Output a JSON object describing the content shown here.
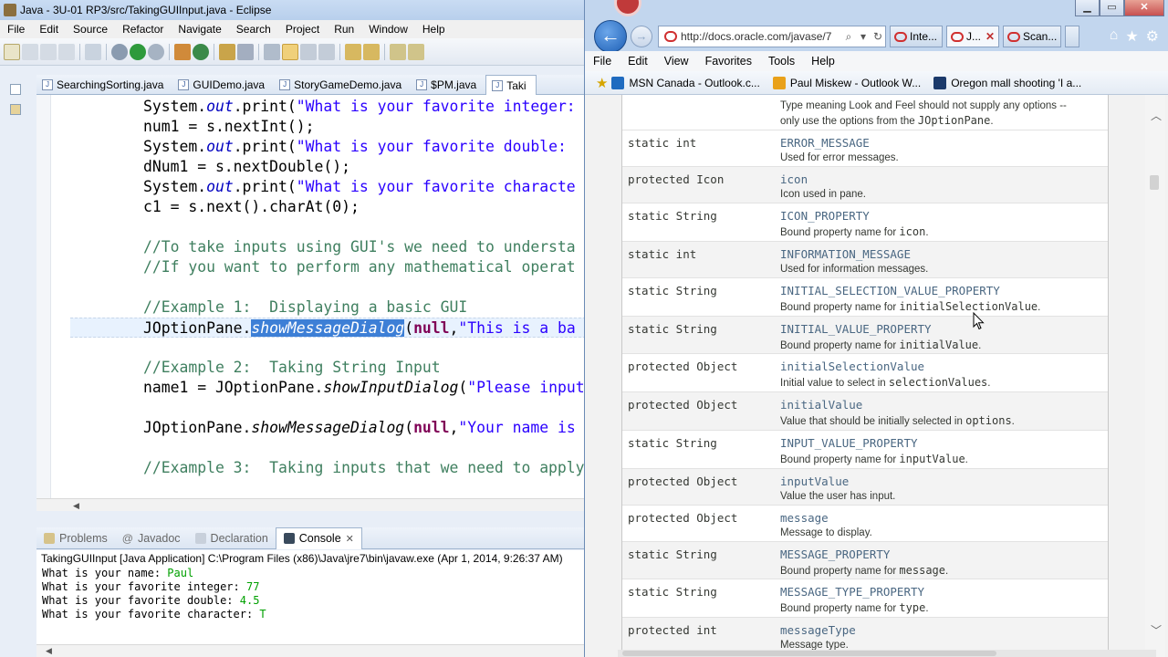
{
  "eclipse": {
    "title": "Java - 3U-01 RP3/src/TakingGUIInput.java - Eclipse",
    "menu": [
      "File",
      "Edit",
      "Source",
      "Refactor",
      "Navigate",
      "Search",
      "Project",
      "Run",
      "Window",
      "Help"
    ],
    "tabs": [
      "SearchingSorting.java",
      "GUIDemo.java",
      "StoryGameDemo.java",
      "$PM.java",
      "Taki"
    ],
    "code": [
      "System.out.print(\"What is your favorite integer:",
      "num1 = s.nextInt();",
      "System.out.print(\"What is your favorite double: ",
      "dNum1 = s.nextDouble();",
      "System.out.print(\"What is your favorite characte",
      "c1 = s.next().charAt(0);",
      "",
      "//To take inputs using GUI's we need to understa",
      "//If you want to perform any mathematical operat",
      "",
      "//Example 1:  Displaying a basic GUI",
      "JOptionPane.showMessageDialog(null,\"This is a ba",
      "",
      "//Example 2:  Taking String Input",
      "name1 = JOptionPane.showInputDialog(\"Please input",
      "",
      "JOptionPane.showMessageDialog(null,\"Your name is",
      "",
      "//Example 3:  Taking inputs that we need to apply"
    ],
    "bottom_tabs": [
      "Problems",
      "Javadoc",
      "Declaration",
      "Console"
    ],
    "console_header": "TakingGUIInput [Java Application] C:\\Program Files (x86)\\Java\\jre7\\bin\\javaw.exe (Apr 1, 2014, 9:26:37 AM)",
    "console": [
      {
        "prompt": "What is your name: ",
        "input": "Paul"
      },
      {
        "prompt": "What is your favorite integer: ",
        "input": "77"
      },
      {
        "prompt": "What is your favorite double: ",
        "input": "4.5"
      },
      {
        "prompt": "What is your favorite character: ",
        "input": "T"
      }
    ]
  },
  "browser": {
    "address": "http://docs.oracle.com/javase/7",
    "tabs": [
      "Inte...",
      "J...",
      "Scan..."
    ],
    "menu": [
      "File",
      "Edit",
      "View",
      "Favorites",
      "Tools",
      "Help"
    ],
    "favorites": [
      "MSN Canada - Outlook.c...",
      "Paul Miskew - Outlook W...",
      "Oregon mall shooting 'I a..."
    ],
    "top_partial": "Type meaning Look and Feel should not supply any options --",
    "top_partial2": "only use the options from the",
    "top_partial2_code": "JOptionPane",
    "fields": [
      {
        "mod": "static int",
        "name": "ERROR_MESSAGE",
        "desc": "Used for error messages.",
        "code": ""
      },
      {
        "mod": "protected Icon",
        "name": "icon",
        "desc": "Icon used in pane.",
        "code": ""
      },
      {
        "mod": "static String",
        "name": "ICON_PROPERTY",
        "desc": "Bound property name for",
        "code": "icon"
      },
      {
        "mod": "static int",
        "name": "INFORMATION_MESSAGE",
        "desc": "Used for information messages.",
        "code": ""
      },
      {
        "mod": "static String",
        "name": "INITIAL_SELECTION_VALUE_PROPERTY",
        "desc": "Bound property name for",
        "code": "initialSelectionValue"
      },
      {
        "mod": "static String",
        "name": "INITIAL_VALUE_PROPERTY",
        "desc": "Bound property name for",
        "code": "initialValue"
      },
      {
        "mod": "protected Object",
        "name": "initialSelectionValue",
        "desc": "Initial value to select in",
        "code": "selectionValues"
      },
      {
        "mod": "protected Object",
        "name": "initialValue",
        "desc": "Value that should be initially selected in",
        "code": "options"
      },
      {
        "mod": "static String",
        "name": "INPUT_VALUE_PROPERTY",
        "desc": "Bound property name for",
        "code": "inputValue"
      },
      {
        "mod": "protected Object",
        "name": "inputValue",
        "desc": "Value the user has input.",
        "code": ""
      },
      {
        "mod": "protected Object",
        "name": "message",
        "desc": "Message to display.",
        "code": ""
      },
      {
        "mod": "static String",
        "name": "MESSAGE_PROPERTY",
        "desc": "Bound property name for",
        "code": "message"
      },
      {
        "mod": "static String",
        "name": "MESSAGE_TYPE_PROPERTY",
        "desc": "Bound property name for",
        "code": "type"
      },
      {
        "mod": "protected int",
        "name": "messageType",
        "desc": "Message type.",
        "code": ""
      }
    ]
  }
}
